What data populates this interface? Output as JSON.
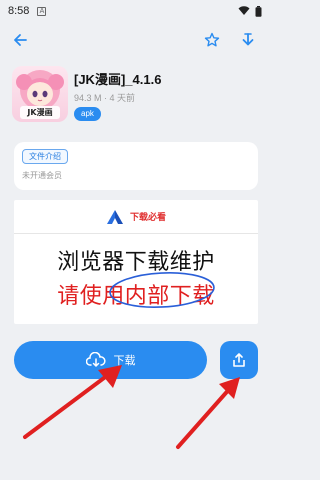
{
  "status": {
    "time": "8:58",
    "notification_icon": "A"
  },
  "app": {
    "name": "[JK漫画]_4.1.6",
    "meta": "94.3 M · 4 天前",
    "badge": "apk",
    "icon_caption": "JK漫画"
  },
  "intro": {
    "chip_label": "文件介绍",
    "text": "未开通会员"
  },
  "banner": {
    "brand": "下载必看",
    "line1": "浏览器下载维护",
    "line2": "请使用内部下载"
  },
  "actions": {
    "download_label": "下载"
  },
  "colors": {
    "accent": "#2a8cf0",
    "background": "#eef0f3",
    "annotation_red": "#e02020",
    "circle_blue": "#2a5fd8"
  }
}
